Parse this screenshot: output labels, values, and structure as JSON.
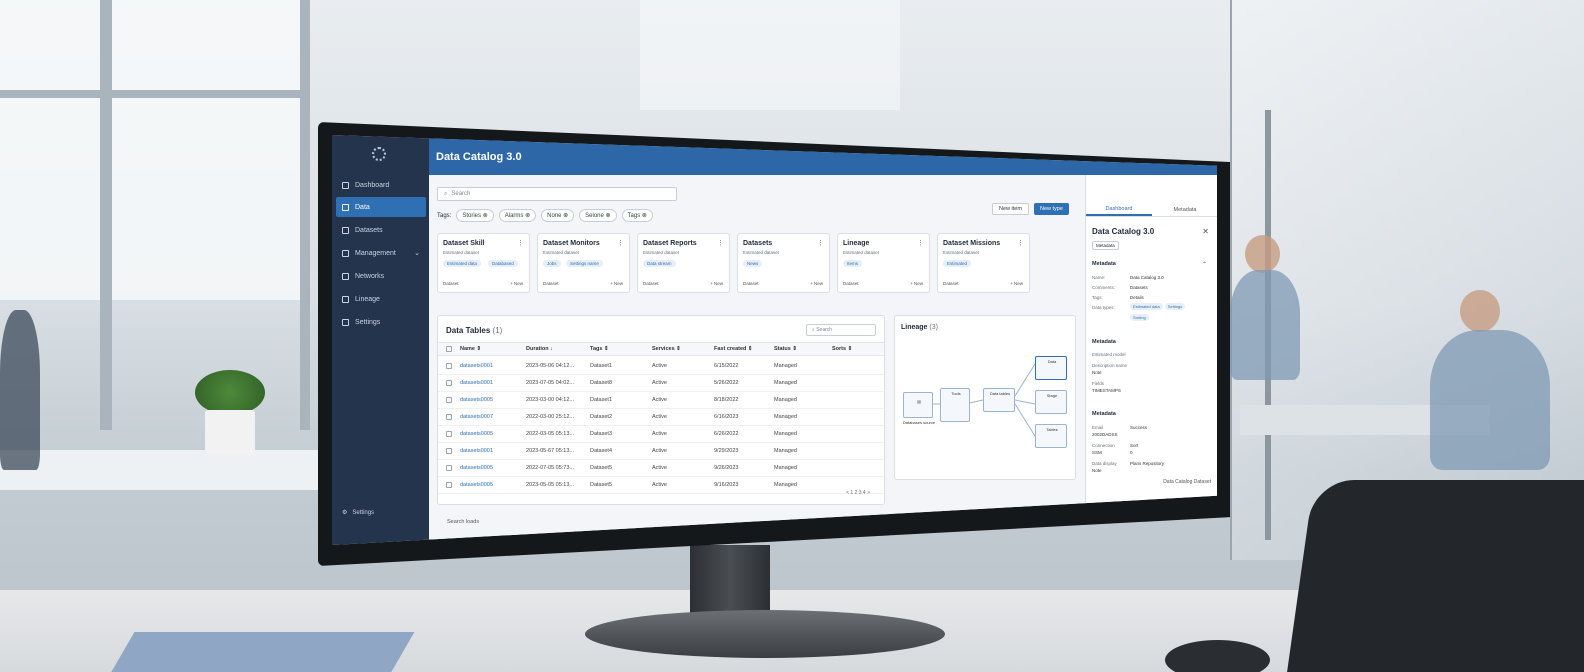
{
  "app": {
    "title": "Data Catalog 3.0"
  },
  "sidebar": {
    "items": [
      {
        "label": "Dashboard",
        "icon": "dashboard-icon"
      },
      {
        "label": "Data",
        "icon": "database-icon",
        "active": true
      },
      {
        "label": "Datasets",
        "icon": "tag-icon"
      },
      {
        "label": "Management",
        "icon": "key-icon"
      },
      {
        "label": "Networks",
        "icon": "folder-icon"
      },
      {
        "label": "Lineage",
        "icon": "list-icon"
      },
      {
        "label": "Settings",
        "icon": "gear-icon"
      }
    ],
    "footer_label": "Settings"
  },
  "search": {
    "placeholder": "Search"
  },
  "tags": {
    "label": "Tags:",
    "items": [
      "Stories",
      "Alarms",
      "None",
      "Selone",
      "Tags"
    ]
  },
  "toolbar": {
    "secondary_label": "New item",
    "primary_label": "New type"
  },
  "cards": [
    {
      "title": "Dataset Skill",
      "subtitle": "Estimated dataset",
      "badges": [
        "Estimated data",
        "Databased"
      ],
      "footer": "Dataset",
      "action": "+ New"
    },
    {
      "title": "Dataset Monitors",
      "subtitle": "Estimated dataset",
      "badges": [
        "Jobs",
        "Settings name"
      ],
      "footer": "Dataset",
      "action": "+ New"
    },
    {
      "title": "Dataset Reports",
      "subtitle": "Estimated dataset",
      "badges": [
        "Data stream"
      ],
      "footer": "Dataset",
      "action": "+ New"
    },
    {
      "title": "Datasets",
      "subtitle": "Estimated dataset",
      "badges": [
        "News"
      ],
      "footer": "Dataset",
      "action": "+ New"
    },
    {
      "title": "Lineage",
      "subtitle": "Estimated dataset",
      "badges": [
        "Items"
      ],
      "footer": "Dataset",
      "action": "+ New"
    },
    {
      "title": "Dataset Missions",
      "subtitle": "Estimated dataset",
      "badges": [
        "Estimated"
      ],
      "footer": "Dataset",
      "action": "+ New"
    }
  ],
  "table": {
    "title": "Data Tables",
    "count": "(1)",
    "search_placeholder": "Search",
    "columns": [
      "Name",
      "Duration",
      "Tags",
      "Services",
      "Fast created",
      "Status",
      "Sorts"
    ],
    "rows": [
      [
        "datasets0001",
        "2023-05-06 04:12...",
        "Dataset1",
        "Active",
        "6/15/2022",
        "Managed",
        ""
      ],
      [
        "datasets0001",
        "2023-07-05 04:02...",
        "Dataset8",
        "Active",
        "5/26/2022",
        "Managed",
        ""
      ],
      [
        "datasets0005",
        "2023-03-00 04:12...",
        "Dataset1",
        "Active",
        "8/18/2022",
        "Managed",
        ""
      ],
      [
        "datasets0007",
        "2022-03-00 25:12...",
        "Dataset2",
        "Active",
        "6/16/2023",
        "Managed",
        ""
      ],
      [
        "datasets0005",
        "2022-03-05 05:13...",
        "Dataset3",
        "Active",
        "6/26/2022",
        "Managed",
        ""
      ],
      [
        "datasets0001",
        "2023-05-67 05:13...",
        "Dataset4",
        "Active",
        "9/29/2023",
        "Managed",
        ""
      ],
      [
        "datasets0005",
        "2022-07-05 05:73...",
        "Dataset5",
        "Active",
        "9/26/2023",
        "Managed",
        ""
      ],
      [
        "datasets0005",
        "2023-05-05 05:13...",
        "Dataset5",
        "Active",
        "9/16/2023",
        "Managed",
        ""
      ]
    ],
    "pager": "< 1 2 3 4 >",
    "footer": "Search loads"
  },
  "lineage": {
    "title": "Lineage",
    "count": "(3)",
    "nodes": [
      "Databases source",
      "Tools",
      "Data tables",
      "Data",
      "Stage",
      "Tables"
    ]
  },
  "panel": {
    "tabs": [
      "Dashboard",
      "Metadata"
    ],
    "title": "Data Catalog 3.0",
    "badge": "Metadata",
    "sections": [
      {
        "title": "Metadata",
        "rows": [
          [
            "Name:",
            "Data Catalog 3.0"
          ],
          [
            "Comments:",
            "Datasets"
          ],
          [
            "Tags:",
            "Details"
          ],
          [
            "Data types:",
            ""
          ]
        ],
        "tags": [
          "Estimated data",
          "Settings",
          "Sorting"
        ]
      },
      {
        "title": "Metadata",
        "rows": [
          [
            "Estimated model",
            ""
          ],
          [
            "Description name",
            "Note"
          ],
          [
            "Fields",
            "TIMESTAMPS"
          ]
        ]
      },
      {
        "title": "Metadata",
        "rows": [
          [
            "Email",
            "Success"
          ],
          [
            "2002DADSS",
            ""
          ],
          [
            "Connection",
            "Sort"
          ],
          [
            "SSM",
            "0"
          ],
          [
            "Data display",
            "Plans Repository"
          ],
          [
            "Note",
            ""
          ]
        ]
      }
    ],
    "footer": "Data Catalog Dataset"
  },
  "colors": {
    "accent": "#2e67a8",
    "sidebar": "#24344d"
  }
}
